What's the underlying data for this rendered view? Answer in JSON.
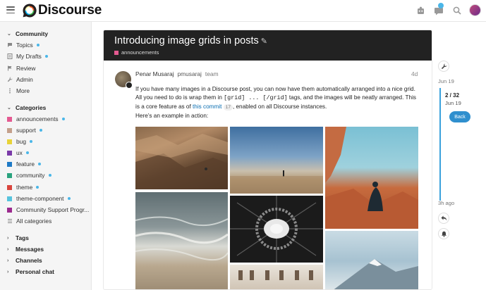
{
  "header": {
    "logo_text": "Discourse",
    "icons": [
      "puzzle-icon",
      "chat-icon",
      "search-icon",
      "avatar"
    ]
  },
  "sidebar": {
    "community": {
      "heading": "Community",
      "items": [
        {
          "label": "Topics",
          "icon": "topics-icon",
          "dot": true
        },
        {
          "label": "My Drafts",
          "icon": "drafts-icon",
          "dot": true
        },
        {
          "label": "Review",
          "icon": "flag-icon",
          "dot": false
        },
        {
          "label": "Admin",
          "icon": "wrench-icon",
          "dot": false
        },
        {
          "label": "More",
          "icon": "more-icon",
          "dot": false
        }
      ]
    },
    "categories": {
      "heading": "Categories",
      "items": [
        {
          "label": "announcements",
          "color": "#e45a91",
          "dot": true
        },
        {
          "label": "support",
          "color": "#c4a08c",
          "dot": true
        },
        {
          "label": "bug",
          "color": "#e8d338",
          "dot": true
        },
        {
          "label": "ux",
          "color": "#7a3aa8",
          "dot": true
        },
        {
          "label": "feature",
          "color": "#1f7ac6",
          "dot": true
        },
        {
          "label": "community",
          "color": "#2aa37e",
          "dot": true
        },
        {
          "label": "theme",
          "color": "#d9453d",
          "dot": true
        },
        {
          "label": "theme-component",
          "color": "#56c3dd",
          "dot": true
        },
        {
          "label": "Community Support Progr...",
          "color": "#9b2a8e",
          "dot": false
        }
      ],
      "all_label": "All categories"
    },
    "sections": [
      {
        "label": "Tags"
      },
      {
        "label": "Messages"
      },
      {
        "label": "Channels"
      },
      {
        "label": "Personal chat"
      }
    ]
  },
  "topic": {
    "title": "Introducing image grids in posts",
    "category": "announcements",
    "category_color": "#e45a91"
  },
  "post": {
    "author_name": "Penar Musaraj",
    "author_username": "pmusaraj",
    "author_group": "team",
    "date": "4d",
    "body_part1": "If you have many images in a Discourse post, you can now have them automatically arranged into a nice grid. All you need to do is wrap them in ",
    "code1": "[grid] ... [/grid]",
    "body_part2": " tags, and the images will be neatly arranged. This is a core feature as of ",
    "link_text": "this commit",
    "link_count": "17",
    "body_part3": ", enabled on all Discourse instances.",
    "example_text": "Here’s an example in action:"
  },
  "timeline": {
    "top_date": "Jun 19",
    "count": "2 / 32",
    "current_date": "Jun 19",
    "back_label": "Back",
    "bottom_label": "3h ago"
  }
}
